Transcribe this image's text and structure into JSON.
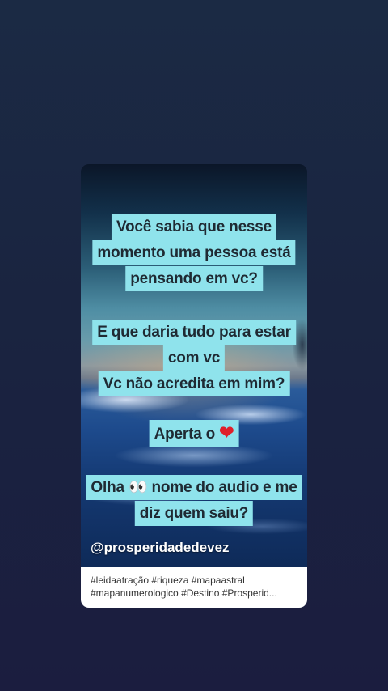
{
  "post": {
    "lines": [
      "Você sabia que nesse",
      "momento uma pessoa está",
      "pensando em vc?",
      "E que daria tudo para estar",
      "com vc",
      "Vc não acredita em mim?",
      "Aperta o",
      "Olha 👀 nome do audio e me",
      "diz quem saiu?"
    ],
    "heart_glyph": "❤",
    "handle": "@prosperidadedevez"
  },
  "caption": {
    "line1": "#leidaatração #riqueza #mapaastral",
    "line2": "#mapanumerologico #Destino #Prosperid..."
  },
  "colors": {
    "highlight": "#8fe3ec",
    "text": "#1f2a33",
    "heart": "#e0202a"
  }
}
